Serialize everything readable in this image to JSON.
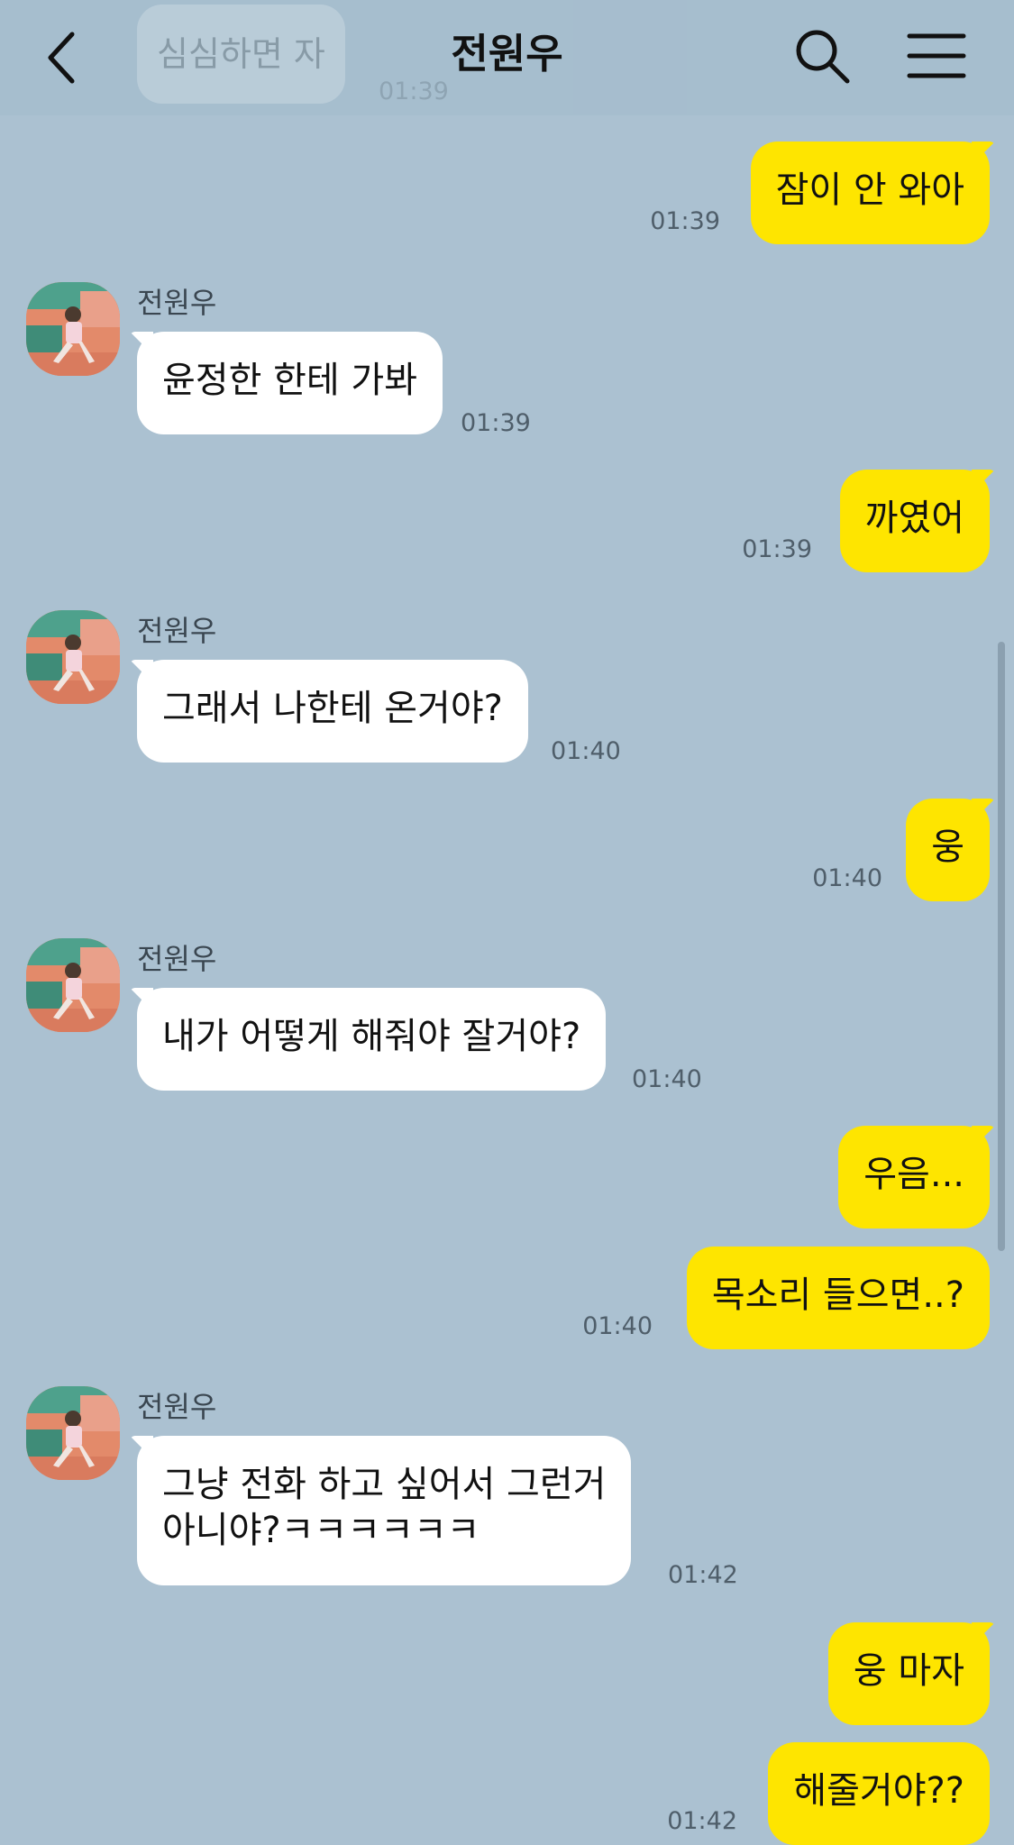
{
  "header": {
    "title": "전원우"
  },
  "previous": {
    "text": "심심하면 자",
    "time": "01:39"
  },
  "contact_name": "전원우",
  "messages": [
    {
      "text": "잠이 안 와아",
      "time": "01:39"
    },
    {
      "text": "윤정한 한테 가봐",
      "time": "01:39"
    },
    {
      "text": "까였어",
      "time": "01:39"
    },
    {
      "text": "그래서 나한테 온거야?",
      "time": "01:40"
    },
    {
      "text": "웅",
      "time": "01:40"
    },
    {
      "text": "내가 어떻게 해줘야 잘거야?",
      "time": "01:40"
    },
    {
      "text": "우음..."
    },
    {
      "text": "목소리 들으면..?",
      "time": "01:40"
    },
    {
      "line1": "그냥 전화 하고 싶어서 그런거",
      "line2": "아니야?ㅋㅋㅋㅋㅋㅋ",
      "time": "01:42"
    },
    {
      "text": "웅 마자"
    },
    {
      "text": "해줄거야??",
      "time": "01:42"
    }
  ],
  "colors": {
    "background": "#abc1d1",
    "my_bubble": "#fee500",
    "their_bubble": "#ffffff"
  },
  "icons": {
    "back": "chevron-left-icon",
    "search": "search-icon",
    "menu": "hamburger-menu-icon",
    "avatar": "profile-photo"
  }
}
